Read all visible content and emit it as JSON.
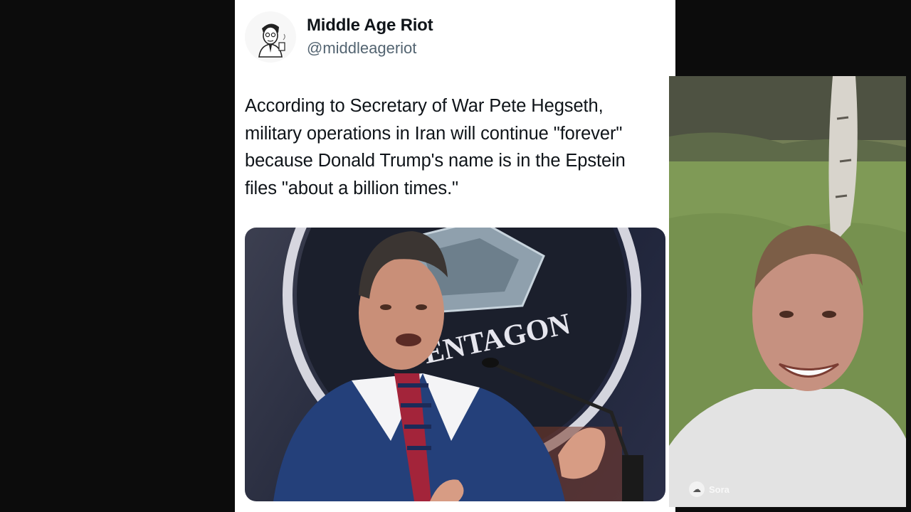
{
  "post": {
    "author": {
      "display_name": "Middle Age Riot",
      "handle": "@middleageriot",
      "avatar_icon": "retro-man-cartoon-avatar"
    },
    "text": "According to Secretary of War Pete Hegseth, military operations in Iran will continue \"forever\" because Donald Trump's name is in the Epstein files \"about a billion times.\"",
    "media": {
      "sign_text": "ENTAGON"
    }
  },
  "overlay_video": {
    "watermark_text": "Sora",
    "watermark_icon": "sora-cloud-icon"
  },
  "colors": {
    "background": "#0c0c0c",
    "card": "#ffffff",
    "name": "#0f1419",
    "handle": "#536471"
  }
}
